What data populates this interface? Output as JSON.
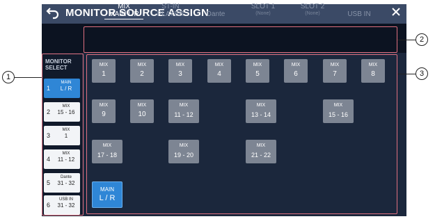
{
  "window": {
    "title": "MONITOR SOURCE ASSIGN"
  },
  "tabs": [
    {
      "label1": "MIX",
      "label2": "MAIN L/R"
    },
    {
      "label1": "ST-IN",
      "label2": "PLAYER"
    },
    {
      "label1": "",
      "label2": "Dante"
    },
    {
      "label1": "SLOT  1",
      "label2": "(None)"
    },
    {
      "label1": "SLOT  2",
      "label2": "(None)"
    },
    {
      "label1": "",
      "label2": "USB IN"
    }
  ],
  "sidebar": {
    "title_line1": "MONITOR",
    "title_line2": "SELECT",
    "items": [
      {
        "num": "1",
        "line1": "MAIN",
        "line2": "L / R"
      },
      {
        "num": "2",
        "line1": "MIX",
        "line2": "15 - 16"
      },
      {
        "num": "3",
        "line1": "MIX",
        "line2": "1"
      },
      {
        "num": "4",
        "line1": "MIX",
        "line2": "11 - 12"
      },
      {
        "num": "5",
        "line1": "Dante",
        "line2": "31 - 32"
      },
      {
        "num": "6",
        "line1": "USB IN",
        "line2": "31 - 32"
      }
    ]
  },
  "sources": [
    {
      "line1": "MIX",
      "line2": "1"
    },
    {
      "line1": "MIX",
      "line2": "2"
    },
    {
      "line1": "MIX",
      "line2": "3"
    },
    {
      "line1": "MIX",
      "line2": "4"
    },
    {
      "line1": "MIX",
      "line2": "5"
    },
    {
      "line1": "MIX",
      "line2": "6"
    },
    {
      "line1": "MIX",
      "line2": "7"
    },
    {
      "line1": "MIX",
      "line2": "8"
    },
    {
      "line1": "MIX",
      "line2": "9"
    },
    {
      "line1": "MIX",
      "line2": "10"
    },
    {
      "line1": "MIX",
      "line2": "11 - 12"
    },
    {
      "line1": "MIX",
      "line2": "13 - 14"
    },
    {
      "line1": "MIX",
      "line2": "15 - 16"
    },
    {
      "line1": "MIX",
      "line2": "17 - 18"
    },
    {
      "line1": "MIX",
      "line2": "19 - 20"
    },
    {
      "line1": "MIX",
      "line2": "21 - 22"
    },
    {
      "line1": "MAIN",
      "line2": "L / R"
    }
  ],
  "callouts": [
    "1",
    "2",
    "3"
  ],
  "colors": {
    "accent": "#2f86d6",
    "button": "#7d8593",
    "panel": "#1b273c",
    "callout": "#e07080"
  }
}
